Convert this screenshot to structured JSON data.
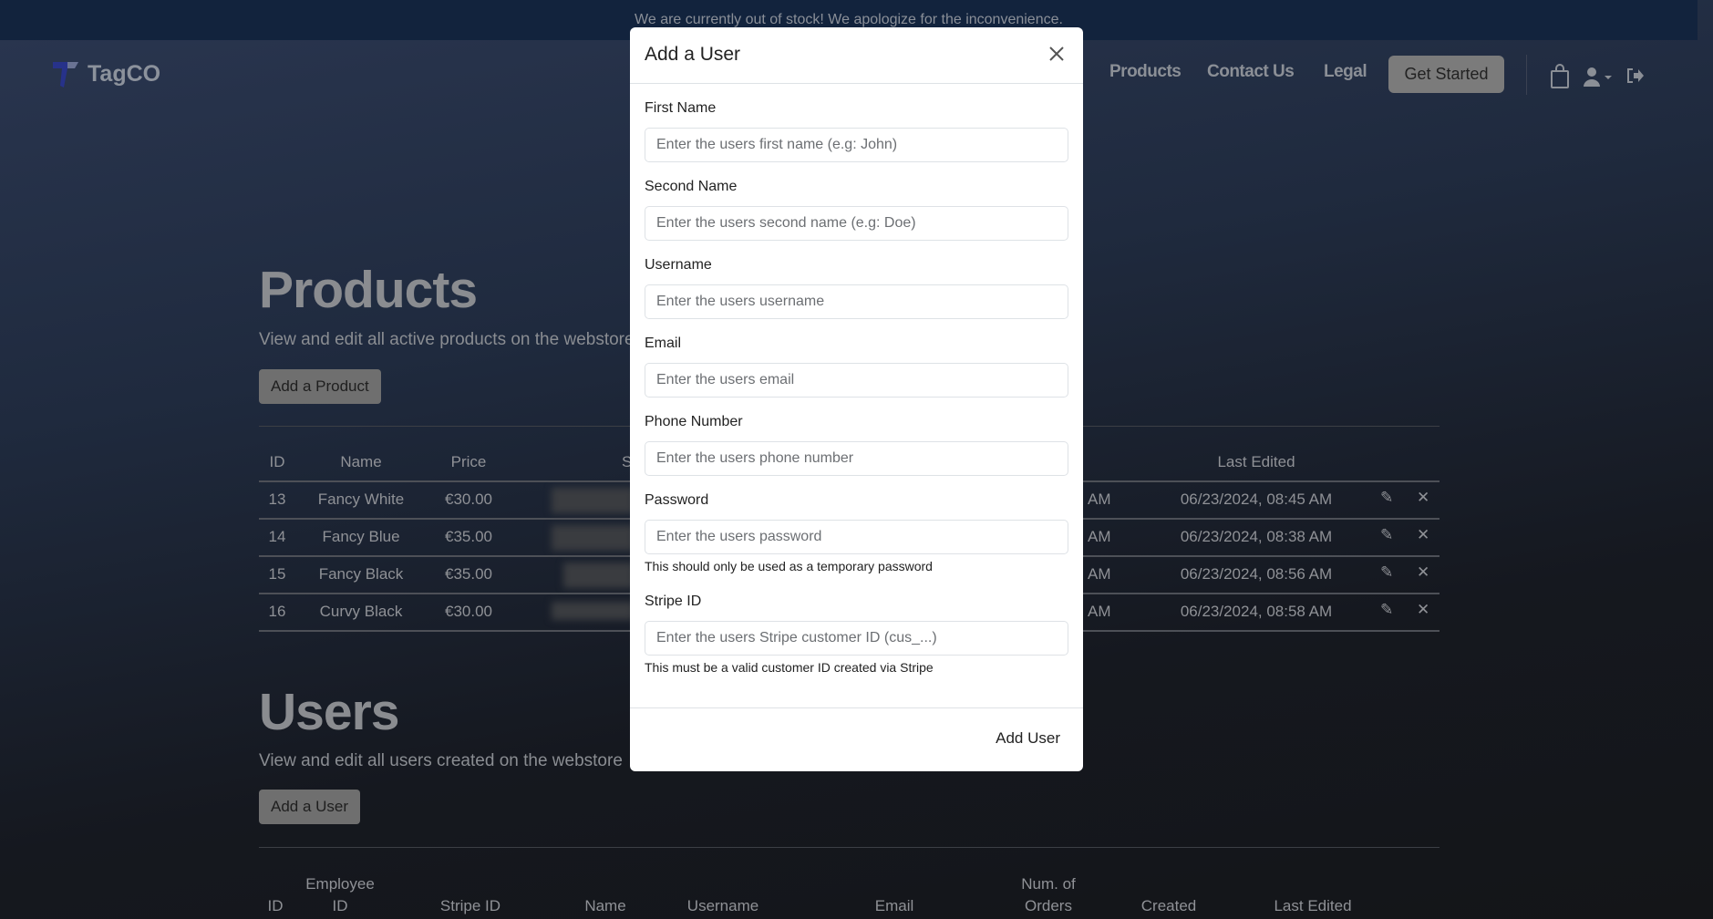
{
  "banner": {
    "text": "We are currently out of stock! We apologize for the inconvenience."
  },
  "nav": {
    "brand": "TagCO",
    "links": [
      "Products",
      "Contact Us",
      "Legal"
    ],
    "cta": "Get Started",
    "icons": [
      "shopping-bag-icon",
      "user-icon",
      "logout-icon"
    ]
  },
  "products": {
    "title": "Products",
    "subtitle": "View and edit all active products on the webstore",
    "add_button": "Add a Product",
    "columns": [
      "ID",
      "Name",
      "Price",
      "S",
      "Last Edited"
    ],
    "rows": [
      {
        "id": "13",
        "name": "Fancy White",
        "price": "€30.00",
        "created_suffix": "AM",
        "last_edited": "06/23/2024, 08:45 AM"
      },
      {
        "id": "14",
        "name": "Fancy Blue",
        "price": "€35.00",
        "created_suffix": "AM",
        "last_edited": "06/23/2024, 08:38 AM"
      },
      {
        "id": "15",
        "name": "Fancy Black",
        "price": "€35.00",
        "created_suffix": "AM",
        "last_edited": "06/23/2024, 08:56 AM"
      },
      {
        "id": "16",
        "name": "Curvy Black",
        "price": "€30.00",
        "created_suffix": "AM",
        "last_edited": "06/23/2024, 08:58 AM"
      }
    ]
  },
  "users": {
    "title": "Users",
    "subtitle": "View and edit all users created on the webstore",
    "add_button": "Add a User",
    "columns": [
      {
        "top": "",
        "bottom": "ID"
      },
      {
        "top": "Employee",
        "bottom": "ID"
      },
      {
        "top": "",
        "bottom": "Stripe ID"
      },
      {
        "top": "",
        "bottom": "Name"
      },
      {
        "top": "",
        "bottom": "Username"
      },
      {
        "top": "",
        "bottom": "Email"
      },
      {
        "top": "Num. of",
        "bottom": "Orders"
      },
      {
        "top": "",
        "bottom": "Created"
      },
      {
        "top": "",
        "bottom": "Last Edited"
      }
    ]
  },
  "modal": {
    "title": "Add a User",
    "submit": "Add User",
    "fields": [
      {
        "label": "First Name",
        "placeholder": "Enter the users first name (e.g: John)",
        "value": ""
      },
      {
        "label": "Second Name",
        "placeholder": "Enter the users second name (e.g: Doe)",
        "value": ""
      },
      {
        "label": "Username",
        "placeholder": "Enter the users username",
        "value": ""
      },
      {
        "label": "Email",
        "placeholder": "Enter the users email",
        "value": ""
      },
      {
        "label": "Phone Number",
        "placeholder": "Enter the users phone number",
        "value": ""
      },
      {
        "label": "Password",
        "placeholder": "Enter the users password",
        "value": "",
        "help": "This should only be used as a temporary password"
      },
      {
        "label": "Stripe ID",
        "placeholder": "Enter the users Stripe customer ID (cus_...)",
        "value": "",
        "help": "This must be a valid customer ID created via Stripe"
      }
    ]
  }
}
